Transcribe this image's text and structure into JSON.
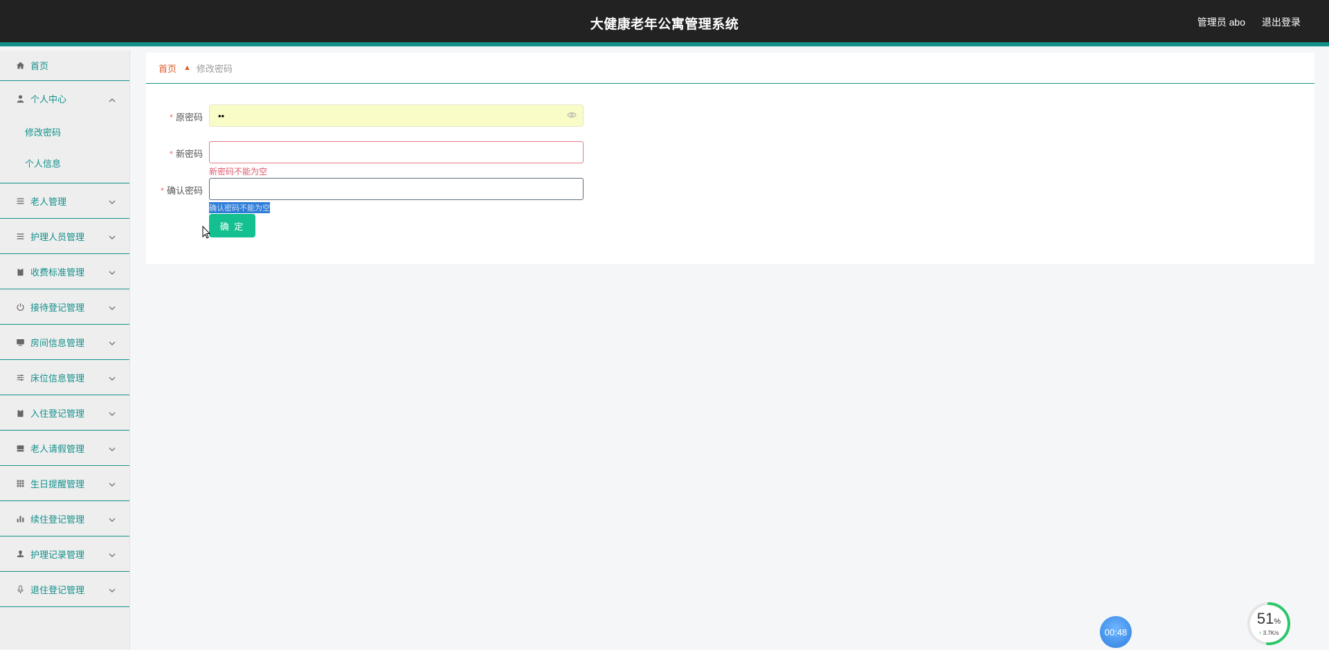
{
  "header": {
    "title": "大健康老年公寓管理系统",
    "user": "管理员 abo",
    "logout": "退出登录"
  },
  "sidebar": {
    "home": "首页",
    "personal_center": {
      "label": "个人中心",
      "children": [
        "修改密码",
        "个人信息"
      ]
    },
    "items": [
      {
        "label": "老人管理",
        "icon": "list-icon"
      },
      {
        "label": "护理人员管理",
        "icon": "list-icon"
      },
      {
        "label": "收费标准管理",
        "icon": "clipboard-icon"
      },
      {
        "label": "接待登记管理",
        "icon": "power-icon"
      },
      {
        "label": "房间信息管理",
        "icon": "monitor-icon"
      },
      {
        "label": "床位信息管理",
        "icon": "sliders-icon"
      },
      {
        "label": "入住登记管理",
        "icon": "clipboard-icon"
      },
      {
        "label": "老人请假管理",
        "icon": "tray-icon"
      },
      {
        "label": "生日提醒管理",
        "icon": "grid-icon"
      },
      {
        "label": "续住登记管理",
        "icon": "bar-chart-icon"
      },
      {
        "label": "护理记录管理",
        "icon": "stamp-icon"
      },
      {
        "label": "退住登记管理",
        "icon": "microphone-icon"
      }
    ]
  },
  "breadcrumb": {
    "home": "首页",
    "current": "修改密码"
  },
  "form": {
    "old_password": {
      "label": "原密码",
      "value": "••"
    },
    "new_password": {
      "label": "新密码",
      "value": "",
      "error": "新密码不能为空"
    },
    "confirm_password": {
      "label": "确认密码",
      "value": "",
      "error": "确认密码不能为空"
    },
    "submit": "确 定"
  },
  "widgets": {
    "timer": "00:48",
    "gauge_percent": 51,
    "gauge_unit": "%",
    "gauge_speed": "3.7K/s"
  },
  "colors": {
    "accent": "#13908a",
    "button": "#14c08f",
    "error": "#e0566a",
    "header_bg": "#222222"
  }
}
